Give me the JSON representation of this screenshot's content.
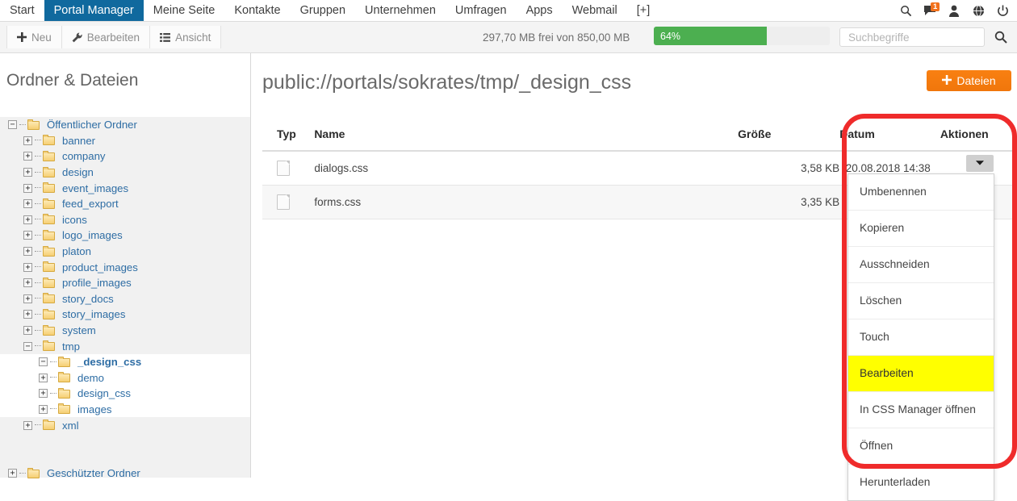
{
  "topnav": {
    "tabs": [
      {
        "label": "Start",
        "active": false
      },
      {
        "label": "Portal Manager",
        "active": true
      },
      {
        "label": "Meine Seite",
        "active": false
      },
      {
        "label": "Kontakte",
        "active": false
      },
      {
        "label": "Gruppen",
        "active": false
      },
      {
        "label": "Unternehmen",
        "active": false
      },
      {
        "label": "Umfragen",
        "active": false
      },
      {
        "label": "Apps",
        "active": false
      },
      {
        "label": "Webmail",
        "active": false
      },
      {
        "label": "[+]",
        "active": false
      }
    ],
    "icons": [
      "search-icon",
      "messages-icon",
      "user-icon",
      "globe-icon",
      "power-icon"
    ],
    "message_badge": "1",
    "active_tab_color": "#10699e"
  },
  "toolbar": {
    "buttons": [
      {
        "label": "Neu",
        "icon": "plus-icon"
      },
      {
        "label": "Bearbeiten",
        "icon": "wrench-icon"
      },
      {
        "label": "Ansicht",
        "icon": "list-icon"
      }
    ],
    "quota_text": "297,70 MB frei von 850,00 MB",
    "progress_label": "64%",
    "progress_percent": 64,
    "progress_color": "#4caf50",
    "search_placeholder": "Suchbegriffe",
    "search_value": "",
    "search_button_icon": "search-icon"
  },
  "sidebar": {
    "title": "Ordner & Dateien",
    "tree": [
      {
        "label": "Öffentlicher Ordner",
        "expander": "minus",
        "depth": 0,
        "bold": false
      },
      {
        "label": "banner",
        "expander": "plus",
        "depth": 1,
        "bold": false
      },
      {
        "label": "company",
        "expander": "plus",
        "depth": 1,
        "bold": false
      },
      {
        "label": "design",
        "expander": "plus",
        "depth": 1,
        "bold": false
      },
      {
        "label": "event_images",
        "expander": "plus",
        "depth": 1,
        "bold": false
      },
      {
        "label": "feed_export",
        "expander": "plus",
        "depth": 1,
        "bold": false
      },
      {
        "label": "icons",
        "expander": "plus",
        "depth": 1,
        "bold": false
      },
      {
        "label": "logo_images",
        "expander": "plus",
        "depth": 1,
        "bold": false
      },
      {
        "label": "platon",
        "expander": "plus",
        "depth": 1,
        "bold": false
      },
      {
        "label": "product_images",
        "expander": "plus",
        "depth": 1,
        "bold": false
      },
      {
        "label": "profile_images",
        "expander": "plus",
        "depth": 1,
        "bold": false
      },
      {
        "label": "story_docs",
        "expander": "plus",
        "depth": 1,
        "bold": false
      },
      {
        "label": "story_images",
        "expander": "plus",
        "depth": 1,
        "bold": false
      },
      {
        "label": "system",
        "expander": "plus",
        "depth": 1,
        "bold": false
      },
      {
        "label": "tmp",
        "expander": "minus",
        "depth": 1,
        "bold": false
      }
    ],
    "subtree": [
      {
        "label": "_design_css",
        "expander": "minus",
        "depth": 2,
        "bold": true
      },
      {
        "label": "demo",
        "expander": "plus",
        "depth": 2,
        "bold": false
      },
      {
        "label": "design_css",
        "expander": "plus",
        "depth": 2,
        "bold": false
      },
      {
        "label": "images",
        "expander": "plus",
        "depth": 2,
        "bold": false
      }
    ],
    "tree_tail": [
      {
        "label": "xml",
        "expander": "plus",
        "depth": 1,
        "bold": false
      }
    ],
    "protected": {
      "label": "Geschützter Ordner",
      "expander": "plus"
    }
  },
  "main": {
    "path": "public://portals/sokrates/tmp/_design_css",
    "upload_button": {
      "label": "Dateien",
      "icon": "plus-icon",
      "color": "#f4790c"
    },
    "table": {
      "headers": [
        "Typ",
        "Name",
        "Größe",
        "Datum",
        "Aktionen"
      ],
      "rows": [
        {
          "icon": "file-icon",
          "name": "dialogs.css",
          "size": "3,58 KB",
          "date": "20.08.2018 14:38",
          "action_icon": "chevron-down-icon"
        },
        {
          "icon": "file-icon",
          "name": "forms.css",
          "size": "3,35 KB",
          "date": "",
          "action_icon": ""
        }
      ]
    },
    "dropdown": {
      "items": [
        {
          "label": "Umbenennen",
          "highlighted": false
        },
        {
          "label": "Kopieren",
          "highlighted": false
        },
        {
          "label": "Ausschneiden",
          "highlighted": false
        },
        {
          "label": "Löschen",
          "highlighted": false
        },
        {
          "label": "Touch",
          "highlighted": false
        },
        {
          "label": "Bearbeiten",
          "highlighted": true
        },
        {
          "label": "In CSS Manager öffnen",
          "highlighted": false
        },
        {
          "label": "Öffnen",
          "highlighted": false
        },
        {
          "label": "Herunterladen",
          "highlighted": false
        }
      ],
      "highlight_color": "#ffff00"
    },
    "annotation": {
      "shape": "rounded-rect",
      "color": "#ef2b2b"
    }
  }
}
